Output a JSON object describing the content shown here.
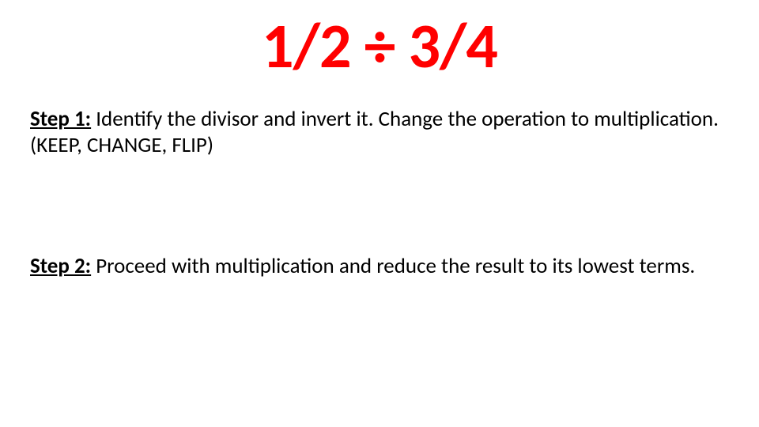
{
  "title": "1/2 ÷ 3/4",
  "steps": [
    {
      "label": "Step 1:",
      "text": " Identify the divisor and invert it. Change the operation to multiplication. (KEEP, CHANGE, FLIP)"
    },
    {
      "label": "Step 2:",
      "text": " Proceed with multiplication and reduce the result to its lowest terms."
    }
  ]
}
